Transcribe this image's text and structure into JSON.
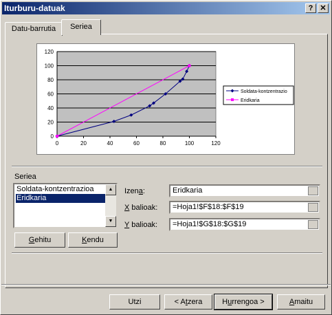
{
  "window": {
    "title": "Iturburu-datuak",
    "help": "?",
    "close": "✕"
  },
  "tabs": [
    {
      "label": "Datu-barrutia"
    },
    {
      "label": "Seriea"
    }
  ],
  "colors": {
    "series1": "#000080",
    "series2": "#ff00ff",
    "plot_bg": "#c0c0c0"
  },
  "chart_data": {
    "type": "scatter",
    "xlim": [
      0,
      120
    ],
    "ylim": [
      0,
      120
    ],
    "xticks": [
      "0",
      "20",
      "40",
      "60",
      "80",
      "100",
      "120"
    ],
    "yticks": [
      "0",
      "20",
      "40",
      "60",
      "80",
      "100",
      "120"
    ],
    "grid": true,
    "legend_position": "right",
    "series": [
      {
        "name": "Soldata-kontzentrazio",
        "x": [
          0,
          43,
          56,
          70,
          73,
          82,
          93,
          95,
          98,
          100
        ],
        "y": [
          0,
          21,
          30,
          43,
          47,
          60,
          78,
          81,
          92,
          100
        ]
      },
      {
        "name": "Eridkaria",
        "x": [
          0,
          100
        ],
        "y": [
          0,
          100
        ]
      }
    ]
  },
  "series_section": {
    "label": "Seriea",
    "items": [
      {
        "label": "Soldata-kontzentrazioa"
      },
      {
        "label": "Eridkaria"
      }
    ],
    "add_prefix": "G",
    "add_rest": "ehitu",
    "remove_prefix": "K",
    "remove_rest": "endu"
  },
  "fields": {
    "name": {
      "prefix": "Izen",
      "underlined": "a",
      "suffix": ":",
      "value": "Eridkaria"
    },
    "x": {
      "prefix": "",
      "underlined": "X",
      "suffix": " balioak:",
      "value": "=Hoja1!$F$18:$F$19"
    },
    "y": {
      "prefix": "",
      "underlined": "Y",
      "suffix": " balioak:",
      "value": "=Hoja1!$G$18:$G$19"
    }
  },
  "footer": {
    "cancel": "Utzi",
    "back_pre": "< A",
    "back_u": "t",
    "back_post": "zera",
    "next_pre": "H",
    "next_u": "u",
    "next_post": "rrengoa >",
    "finish_u": "A",
    "finish_post": "maitu"
  }
}
